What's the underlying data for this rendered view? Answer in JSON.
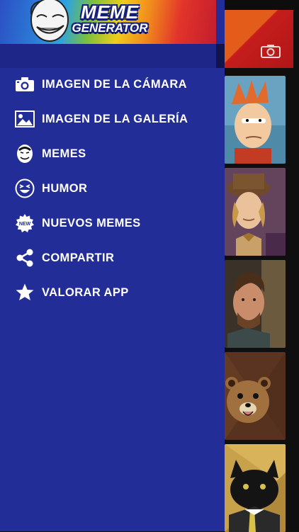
{
  "header": {
    "logo_line1": "MEME",
    "logo_line2": "GENERATOR"
  },
  "menu": {
    "items": [
      {
        "label": "IMAGEN DE LA CÁMARA",
        "icon": "camera-icon"
      },
      {
        "label": "IMAGEN DE LA GALERÍA",
        "icon": "gallery-image-icon"
      },
      {
        "label": "MEMES",
        "icon": "meme-face-icon"
      },
      {
        "label": "HUMOR",
        "icon": "laughing-face-icon"
      },
      {
        "label": "NUEVOS MEMES",
        "icon": "new-badge-icon"
      },
      {
        "label": "COMPARTIR",
        "icon": "share-icon"
      },
      {
        "label": "VALORAR APP",
        "icon": "star-icon"
      }
    ]
  },
  "colors": {
    "drawer": "#232d98",
    "accent_red": "#c61d1d",
    "text": "#ffffff"
  }
}
